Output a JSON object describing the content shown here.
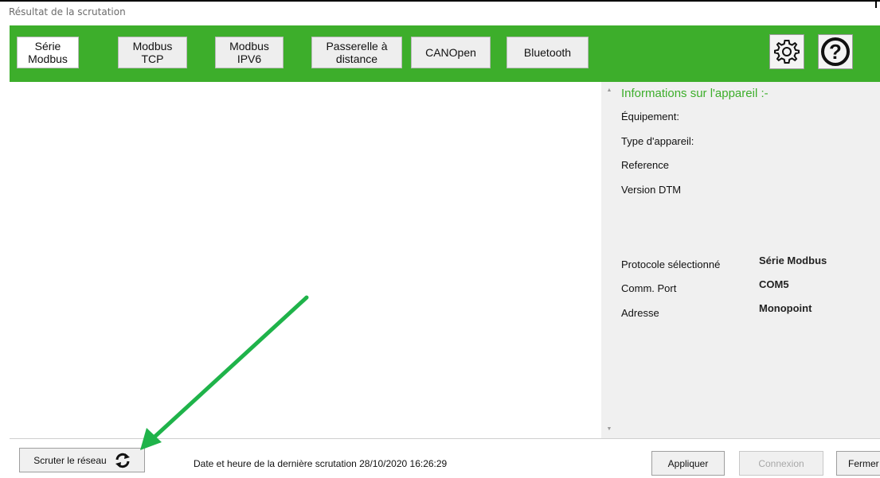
{
  "window": {
    "title": "Résultat de la scrutation"
  },
  "protocols": [
    {
      "label": "Série\nModbus",
      "active": true
    },
    {
      "label": "Modbus\nTCP",
      "active": false
    },
    {
      "label": "Modbus\nIPV6",
      "active": false
    },
    {
      "label": "Passerelle à\ndistance",
      "active": false
    },
    {
      "label": "CANOpen",
      "active": false
    },
    {
      "label": "Bluetooth",
      "active": false
    }
  ],
  "toolbar": {
    "settings_icon": "gear-icon",
    "help_icon": "help-icon",
    "help_glyph": "?"
  },
  "info": {
    "title": "Informations sur l'appareil :-",
    "equipment_label": "Équipement:",
    "device_type_label": "Type d'appareil:",
    "reference_label": "Reference",
    "dtm_version_label": "Version DTM",
    "protocol_label": "Protocole sélectionné",
    "protocol_value": "Série Modbus",
    "port_label": "Comm. Port",
    "port_value": "COM5",
    "address_label": "Adresse",
    "address_value": "Monopoint"
  },
  "footer": {
    "scan_button": "Scruter le réseau",
    "last_scan_text": "Date et heure de la dernière scrutation 28/10/2020 16:26:29",
    "apply_button": "Appliquer",
    "connect_button": "Connexion",
    "close_button": "Fermer"
  },
  "colors": {
    "brand_green": "#3dae2b",
    "annotation_arrow": "#1fb34a"
  }
}
